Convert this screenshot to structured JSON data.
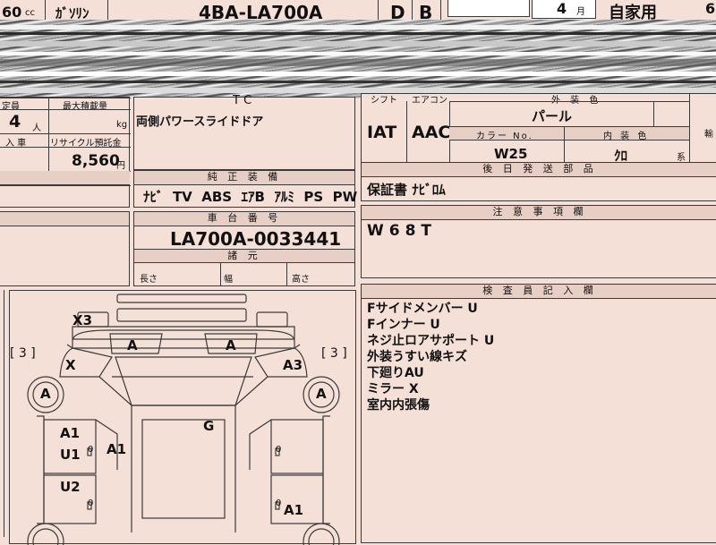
{
  "top": {
    "displacement": "60",
    "displacement_unit": "cc",
    "fuel": "ｶﾞｿﾘﾝ",
    "model_code": "4BA-LA700A",
    "door_label_1": "D",
    "door_label_2": "B",
    "month_value": "4",
    "month_unit": "月",
    "use_type": "自家用",
    "edge_digit": "6"
  },
  "left_info": {
    "capacity_label": "定員",
    "max_load_label": "最大積載量",
    "capacity_value": "4",
    "capacity_unit": "人",
    "load_unit": "kg",
    "import_label": "入 車",
    "recycle_label": "リサイクル預託金",
    "recycle_value": "8,560",
    "recycle_unit": "円"
  },
  "features": {
    "partial_head": "T C",
    "line1": "両側パワースライドドア"
  },
  "factory_equipment": {
    "header": "純 正 装 備",
    "items": "ﾅﾋﾞ  TV  ABS  ｴｱB  ｱﾙﾐ  PS  PW"
  },
  "chassis": {
    "header": "車 台 番 号",
    "number": "LA700A-0033441"
  },
  "specs": {
    "header": "諸 元",
    "length": "長さ",
    "width": "幅",
    "height": "高さ"
  },
  "transmission": {
    "shift": "IAT",
    "aircon": "AAC",
    "shift_header": "シフト",
    "aircon_header": "エアコン"
  },
  "color": {
    "exterior_header": "外 装 色",
    "exterior_value": "パール",
    "color_no_header": "カラー No.",
    "color_no_value": "W25",
    "interior_header": "内 装 色",
    "interior_value": "ｸﾛ",
    "interior_suffix": "系",
    "import_header": "輸"
  },
  "later_parts": {
    "header": "後 日 発 送 部 品",
    "value": "保証書 ﾅﾋﾞﾛﾑ"
  },
  "caution": {
    "header": "注 意 事 項 欄",
    "value": "W68T"
  },
  "inspector": {
    "header": "検 査 員 記 入 欄",
    "lines": [
      "Fサイドメンバー U",
      "Fインナー U",
      "ネジ止ロアサポート U",
      "外装うすい線キズ",
      "下廻りAU",
      "ミラー X",
      "室内内張傷"
    ]
  },
  "diagram": {
    "left_tire": "[ 3 ]",
    "right_tire": "[ 3 ]",
    "m_x3": "X3",
    "m_front_a1": "A",
    "m_front_a2": "A",
    "m_x": "X",
    "m_a3": "A3",
    "m_wheel_a_left": "A",
    "m_wheel_a_right": "A",
    "m_g": "G",
    "m_a1_left": "A1",
    "m_u1_left": "U1",
    "m_a1_mid": "A1",
    "m_u2": "U2",
    "m_a1_right": "A1",
    "m_z1": "0",
    "m_z2": "0",
    "m_z3": "0",
    "m_z4": "0"
  }
}
